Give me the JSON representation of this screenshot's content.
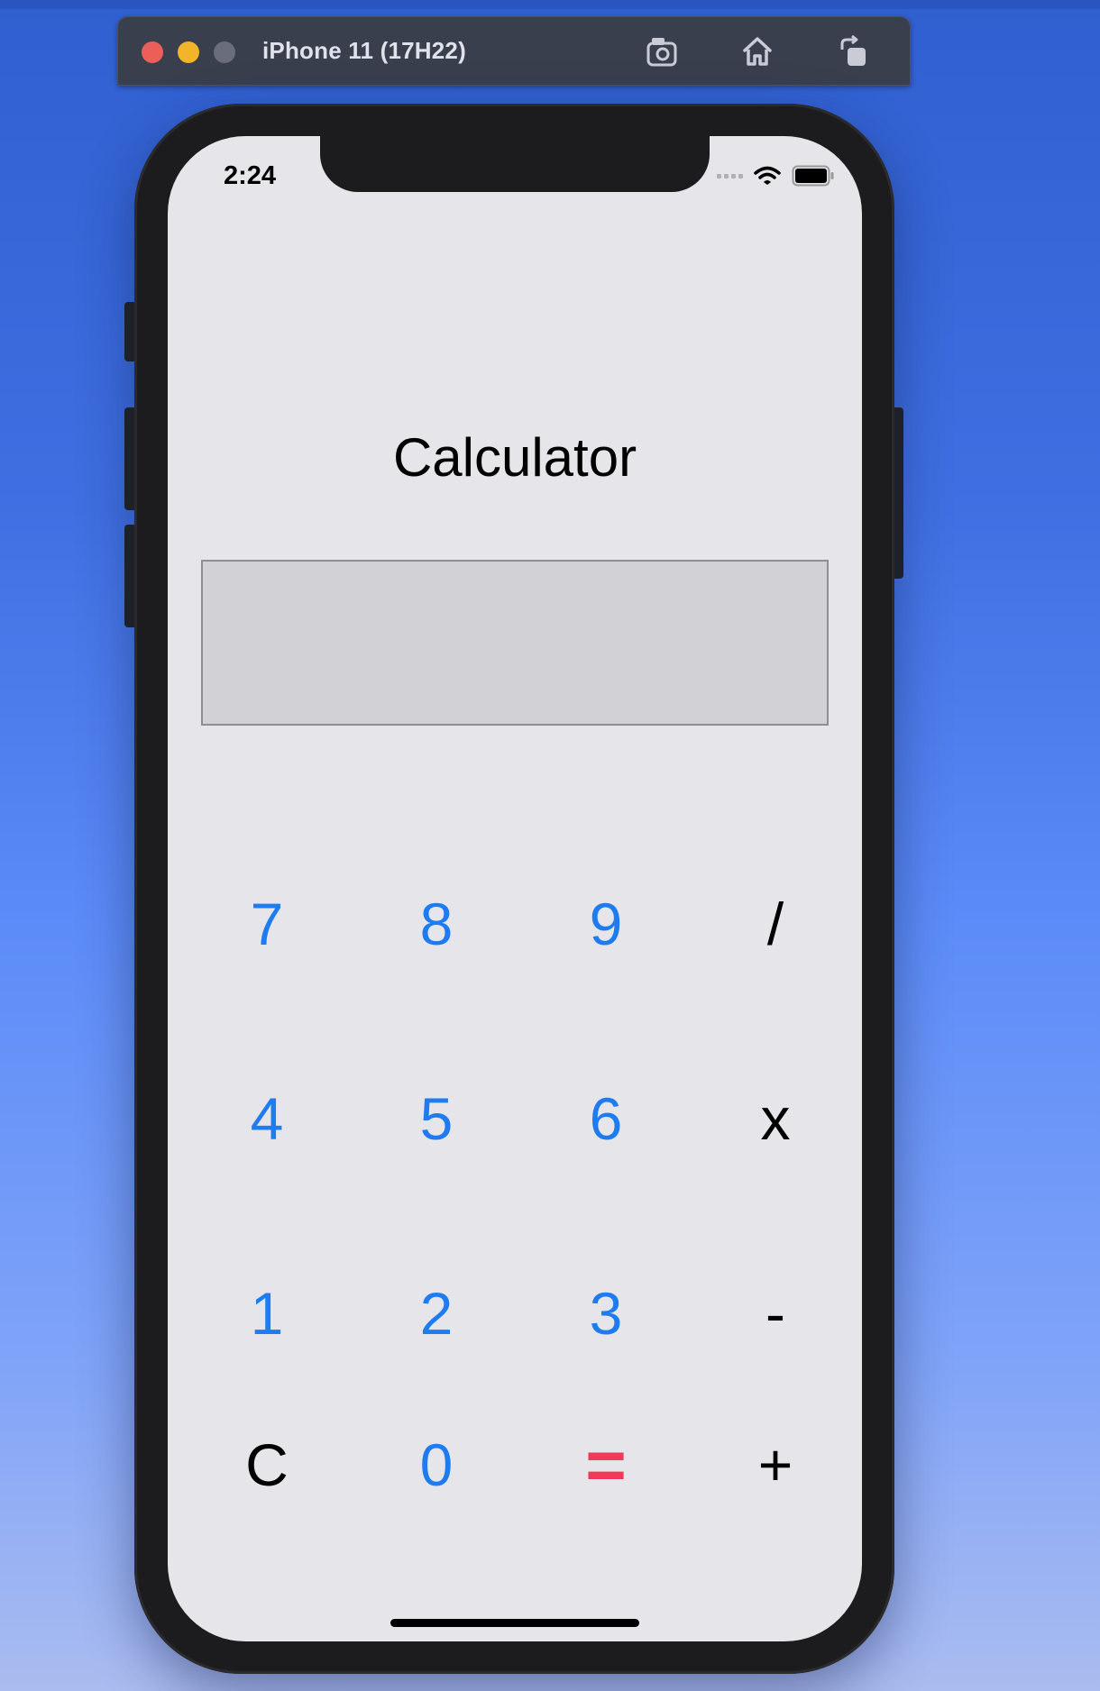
{
  "simulator": {
    "title": "iPhone 11 (17H22)",
    "buttons": [
      "screenshot-icon",
      "home-icon",
      "rotate-icon"
    ]
  },
  "status_bar": {
    "time": "2:24"
  },
  "app": {
    "title": "Calculator",
    "display_value": ""
  },
  "keypad": {
    "rows": [
      [
        "7",
        "8",
        "9",
        "/"
      ],
      [
        "4",
        "5",
        "6",
        "x"
      ],
      [
        "1",
        "2",
        "3",
        "-"
      ],
      [
        "C",
        "0",
        "=",
        "+"
      ]
    ]
  },
  "colors": {
    "digit": "#1f7cf0",
    "operator": "#000000",
    "equals": "#f03a5a",
    "screen_bg": "#e5e5ea",
    "display_bg": "#d1d1d6"
  }
}
